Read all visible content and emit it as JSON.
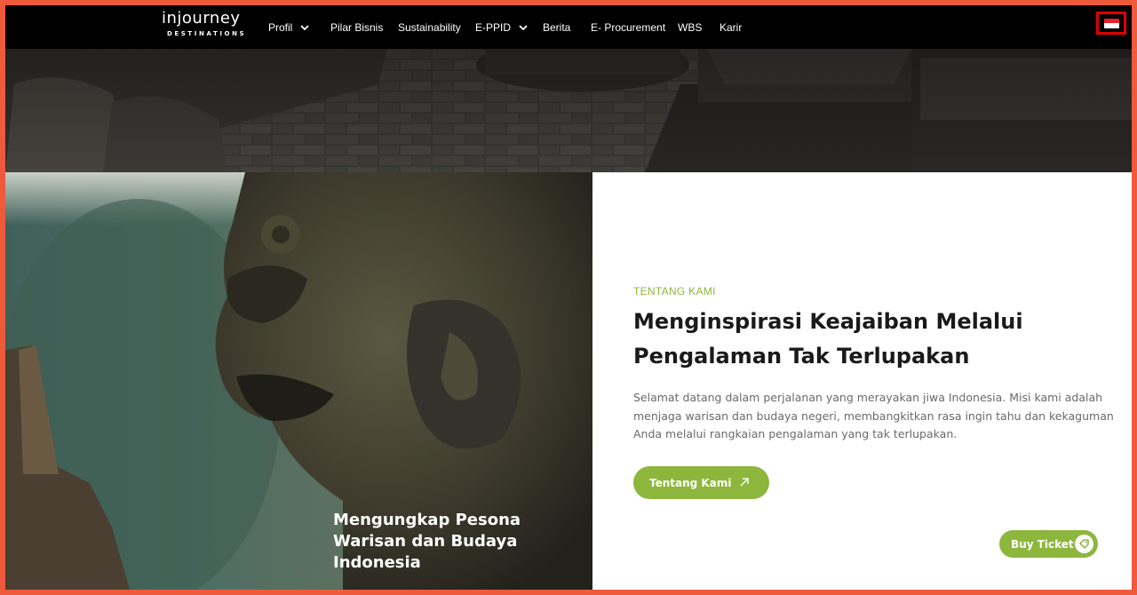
{
  "brand": {
    "logo_main": "injourney",
    "logo_sub": "DESTINATIONS"
  },
  "nav": [
    {
      "label": "Profil",
      "dropdown": true
    },
    {
      "label": "Pilar Bisnis",
      "dropdown": false
    },
    {
      "label": "Sustainability",
      "dropdown": false
    },
    {
      "label": "E-PPID",
      "dropdown": true
    },
    {
      "label": "Berita",
      "dropdown": false
    },
    {
      "label": "E- Procurement",
      "dropdown": false
    },
    {
      "label": "WBS",
      "dropdown": false
    },
    {
      "label": "Karir",
      "dropdown": false
    }
  ],
  "language": {
    "icon": "indonesia-flag-icon",
    "highlight_color": "#e00000"
  },
  "hero": {
    "caption": "Mengungkap Pesona Warisan dan Budaya Indonesia"
  },
  "about": {
    "eyebrow": "TENTANG KAMI",
    "headline": "Menginspirasi Keajaiban Melalui Pengalaman Tak Terlupakan",
    "description": "Selamat datang dalam perjalanan yang merayakan jiwa Indonesia. Misi kami adalah menjaga warisan dan budaya negeri, membangkitkan rasa ingin tahu dan kekaguman Anda melalui rangkaian pengalaman yang tak terlupakan.",
    "cta_label": "Tentang Kami",
    "cta_icon": "arrow-up-right-icon"
  },
  "buy_ticket": {
    "label": "Buy Ticket",
    "icon": "ticket-tag-icon"
  },
  "colors": {
    "accent": "#8db63d",
    "nav_bg": "#000000",
    "frame": "#ee5a3c"
  }
}
